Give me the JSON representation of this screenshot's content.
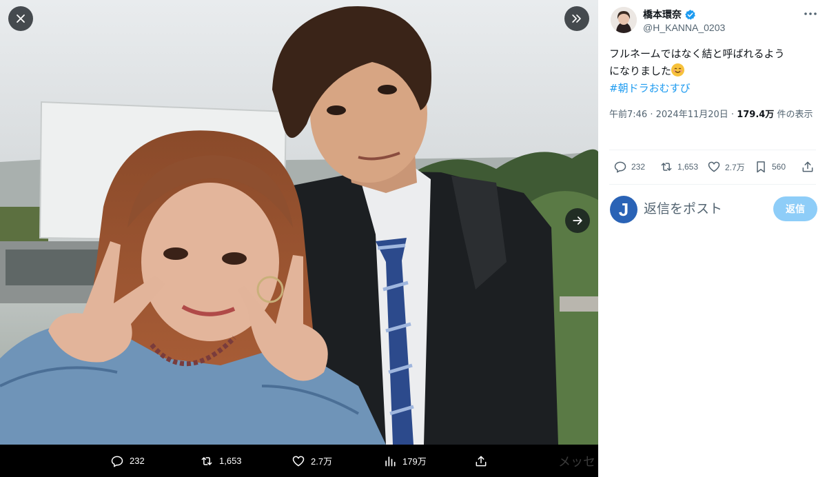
{
  "media_viewer": {
    "stats": {
      "replies": "232",
      "reposts": "1,653",
      "likes": "2.7万",
      "views": "179万"
    },
    "background_text": "メッセ"
  },
  "post": {
    "author": {
      "display_name": "橋本環奈",
      "handle": "@H_KANNA_0203",
      "verified": true
    },
    "text_line1": "フルネームではなく結と呼ばれるよう",
    "text_line2": "になりました",
    "hashtag": "#朝ドラおむすび",
    "meta": {
      "time": "午前7:46",
      "separator1": " · ",
      "date": "2024年11月20日",
      "separator2": " · ",
      "views_count": "179.4万",
      "views_suffix": " 件の表示"
    },
    "actions": {
      "replies": "232",
      "reposts": "1,653",
      "likes": "2.7万",
      "bookmarks": "560"
    }
  },
  "reply_box": {
    "avatar_letter": "J",
    "placeholder": "返信をポスト",
    "button_label": "返信"
  },
  "colors": {
    "accent": "#1d9bf0",
    "verified_badge": "#1d9bf0",
    "reply_button": "#8ecdf8",
    "secondary_text": "#536471"
  }
}
